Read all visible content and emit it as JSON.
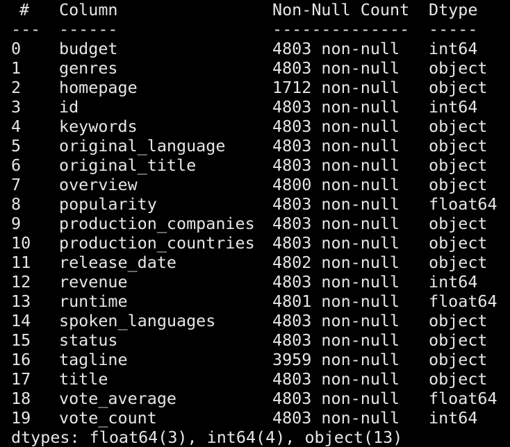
{
  "colors": {
    "background": "#000000",
    "text": "#e6e6e6"
  },
  "header": {
    "num": "#",
    "column": "Column",
    "count": "Non-Null Count",
    "dtype": "Dtype"
  },
  "separator": {
    "num": "---",
    "column": "------",
    "count": "--------------",
    "dtype": "-----"
  },
  "rows": [
    {
      "idx": "0",
      "column": "budget",
      "count": "4803 non-null",
      "dtype": "int64"
    },
    {
      "idx": "1",
      "column": "genres",
      "count": "4803 non-null",
      "dtype": "object"
    },
    {
      "idx": "2",
      "column": "homepage",
      "count": "1712 non-null",
      "dtype": "object"
    },
    {
      "idx": "3",
      "column": "id",
      "count": "4803 non-null",
      "dtype": "int64"
    },
    {
      "idx": "4",
      "column": "keywords",
      "count": "4803 non-null",
      "dtype": "object"
    },
    {
      "idx": "5",
      "column": "original_language",
      "count": "4803 non-null",
      "dtype": "object"
    },
    {
      "idx": "6",
      "column": "original_title",
      "count": "4803 non-null",
      "dtype": "object"
    },
    {
      "idx": "7",
      "column": "overview",
      "count": "4800 non-null",
      "dtype": "object"
    },
    {
      "idx": "8",
      "column": "popularity",
      "count": "4803 non-null",
      "dtype": "float64"
    },
    {
      "idx": "9",
      "column": "production_companies",
      "count": "4803 non-null",
      "dtype": "object"
    },
    {
      "idx": "10",
      "column": "production_countries",
      "count": "4803 non-null",
      "dtype": "object"
    },
    {
      "idx": "11",
      "column": "release_date",
      "count": "4802 non-null",
      "dtype": "object"
    },
    {
      "idx": "12",
      "column": "revenue",
      "count": "4803 non-null",
      "dtype": "int64"
    },
    {
      "idx": "13",
      "column": "runtime",
      "count": "4801 non-null",
      "dtype": "float64"
    },
    {
      "idx": "14",
      "column": "spoken_languages",
      "count": "4803 non-null",
      "dtype": "object"
    },
    {
      "idx": "15",
      "column": "status",
      "count": "4803 non-null",
      "dtype": "object"
    },
    {
      "idx": "16",
      "column": "tagline",
      "count": "3959 non-null",
      "dtype": "object"
    },
    {
      "idx": "17",
      "column": "title",
      "count": "4803 non-null",
      "dtype": "object"
    },
    {
      "idx": "18",
      "column": "vote_average",
      "count": "4803 non-null",
      "dtype": "float64"
    },
    {
      "idx": "19",
      "column": "vote_count",
      "count": "4803 non-null",
      "dtype": "int64"
    }
  ],
  "footer": "dtypes: float64(3), int64(4), object(13)"
}
